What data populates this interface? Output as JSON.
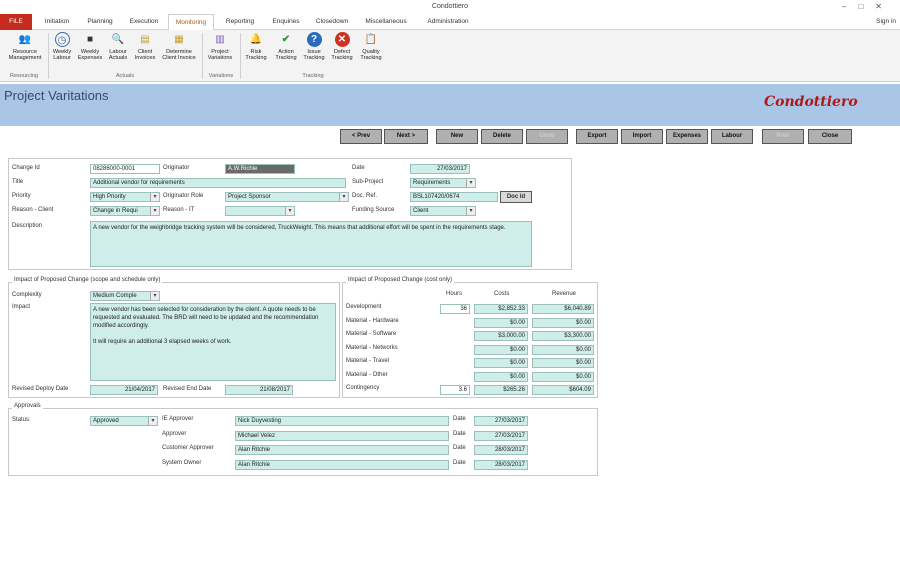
{
  "app": {
    "title": "Condottiero",
    "signin": "Sign in"
  },
  "tabs": [
    "FILE",
    "Initiation",
    "Planning",
    "Execution",
    "Monitoring",
    "Reporting",
    "Enquiries",
    "Closedown",
    "Miscellaneous",
    "Administration"
  ],
  "ribbon": {
    "buttons": [
      {
        "label1": "Resource",
        "label2": "Management",
        "icon": "people-icon"
      },
      {
        "label1": "Weekly",
        "label2": "Labour",
        "icon": "clock-icon"
      },
      {
        "label1": "Weekly",
        "label2": "Expenses",
        "icon": "truck-icon"
      },
      {
        "label1": "Labour",
        "label2": "Actuals",
        "icon": "magnifier-icon"
      },
      {
        "label1": "Client",
        "label2": "Invoices",
        "icon": "invoice-icon"
      },
      {
        "label1": "Determine",
        "label2": "Client Invoice",
        "icon": "calculator-icon"
      },
      {
        "label1": "Project",
        "label2": "Variations",
        "icon": "variations-icon"
      },
      {
        "label1": "Risk",
        "label2": "Tracking",
        "icon": "bell-icon"
      },
      {
        "label1": "Action",
        "label2": "Tracking",
        "icon": "checkmark-icon"
      },
      {
        "label1": "Issue",
        "label2": "Tracking",
        "icon": "question-icon"
      },
      {
        "label1": "Defect",
        "label2": "Tracking",
        "icon": "cancel-icon"
      },
      {
        "label1": "Quality",
        "label2": "Tracking",
        "icon": "clipboard-icon"
      }
    ],
    "groups": [
      "Resourcing",
      "Actuals",
      "Variations",
      "Tracking"
    ]
  },
  "page": {
    "title": "Project Varitations",
    "brand": "Condottiero"
  },
  "toolbar": [
    "< Prev",
    "Next >",
    "New",
    "Delete",
    "Undo",
    "Export",
    "Import",
    "Expenses",
    "Labour",
    "Prev",
    "Close"
  ],
  "main": {
    "change_id_label": "Change Id",
    "change_id": "08286000-0001",
    "originator_label": "Originator",
    "originator": "A.W.Richie",
    "date_label": "Date",
    "date": "27/03/2017",
    "title_label": "Title",
    "title": "Additional vendor for requirements",
    "subproject_label": "Sub-Project",
    "subproject": "Requirements",
    "priority_label": "Priority",
    "priority": "High Priority",
    "originator_role_label": "Originator Role",
    "originator_role": "Project Sponsor",
    "docref_label": "Doc. Ref.",
    "docref": "BSL107420/0674",
    "docid_btn": "Doc Id",
    "reason_client_label": "Reason - Client",
    "reason_client": "Change in Requi",
    "reason_it_label": "Reason - IT",
    "reason_it": "",
    "funding_label": "Funding Source",
    "funding": "Client",
    "description_label": "Description",
    "description": "A new vendor for the weighbridge tracking system will be considered, TruckWeight. This means that additional effort will be spent in the requirements stage."
  },
  "scope": {
    "legend": "Impact of Proposed Change (scope and schedule only)",
    "complexity_label": "Complexity",
    "complexity": "Medium Comple",
    "impact_label": "Impact",
    "impact_p1": "A new vendor has been selected for consideration by the client. A quote needs to be requested and evaluated. The BRD will need to be updated and the recommendation modified accordingly.",
    "impact_p2": "It will require an additional 3 elapsed weeks of work.",
    "deploy_label": "Revised Deploy Date",
    "deploy": "21/04/2017",
    "end_label": "Revised End Date",
    "end": "21/08/2017"
  },
  "cost": {
    "legend": "Impact of Proposed Change (cost only)",
    "headers": [
      "Hours",
      "Costs",
      "Revenue"
    ],
    "rows": [
      {
        "label": "Development",
        "hours": "36",
        "cost": "$2,852.33",
        "revenue": "$6,040.89"
      },
      {
        "label": "Material - Hardware",
        "hours": "",
        "cost": "$0.00",
        "revenue": "$0.00"
      },
      {
        "label": "Material - Software",
        "hours": "",
        "cost": "$3,000.00",
        "revenue": "$3,300.00"
      },
      {
        "label": "Material - Networks",
        "hours": "",
        "cost": "$0.00",
        "revenue": "$0.00"
      },
      {
        "label": "Material - Travel",
        "hours": "",
        "cost": "$0.00",
        "revenue": "$0.00"
      },
      {
        "label": "Material - Other",
        "hours": "",
        "cost": "$0.00",
        "revenue": "$0.00"
      },
      {
        "label": "Contingency",
        "hours": "3.6",
        "cost": "$265.26",
        "revenue": "$604.09"
      }
    ]
  },
  "approvals": {
    "legend": "Approvals",
    "status_label": "Status:",
    "status": "Approved",
    "rows": [
      {
        "role": "IE Approver",
        "name": "Nick Duyvesting",
        "date_label": "Date",
        "date": "27/03/2017"
      },
      {
        "role": "Approver",
        "name": "Michael Velez",
        "date_label": "Date",
        "date": "27/03/2017"
      },
      {
        "role": "Customer Approver",
        "name": "Alan Ritchie",
        "date_label": "Date",
        "date": "28/03/2017"
      },
      {
        "role": "System Owner",
        "name": "Alan Ritchie",
        "date_label": "Date",
        "date": "28/03/2017"
      }
    ]
  }
}
